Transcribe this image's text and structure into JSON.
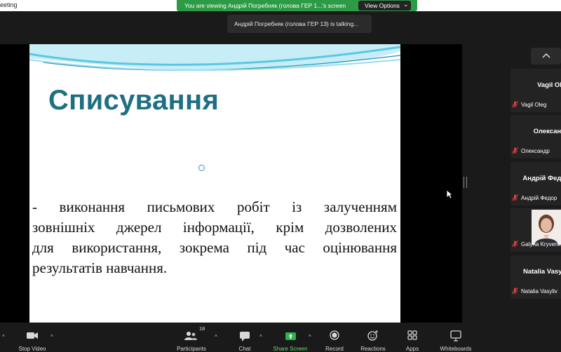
{
  "window": {
    "title_fragment": "eeting"
  },
  "banner": {
    "message": "You are viewing Андрій Погребняк (голова ГЕР 1...'s screen",
    "options_label": "View Options"
  },
  "talking_indicator": "Андрій Погребняк (голова ГЕР 13) is talking...",
  "slide": {
    "title": "Списування",
    "body_lines": [
      "- виконання письмових робіт із залученням",
      "зовнішніх джерел інформації, крім дозволених",
      "для використання, зокрема під час оцінювання",
      "результатів навчання."
    ]
  },
  "participants_panel": {
    "tiles": [
      {
        "display_name": "Vagil Oleg",
        "label": "Vagil Oleg",
        "has_photo": false
      },
      {
        "display_name": "Олександр",
        "label": "Олександр",
        "has_photo": false
      },
      {
        "display_name": "Андрій Федор",
        "label": "Андрій Федор",
        "has_photo": false
      },
      {
        "display_name": "",
        "label": "Galyna Kryvenko",
        "has_photo": true
      },
      {
        "display_name": "Natalia Vasyliv",
        "label": "Natalia Vasyliv",
        "has_photo": false
      }
    ]
  },
  "toolbar": {
    "stop_video": "Stop Video",
    "participants": "Participants",
    "participants_count": "18",
    "chat": "Chat",
    "share_screen": "Share Screen",
    "record": "Record",
    "reactions": "Reactions",
    "apps": "Apps",
    "whiteboards": "Whiteboards"
  },
  "colors": {
    "banner_green": "#2d9b45",
    "slide_title": "#1f6f84",
    "muted_red": "#e0403a",
    "share_green": "#2bb34a"
  }
}
